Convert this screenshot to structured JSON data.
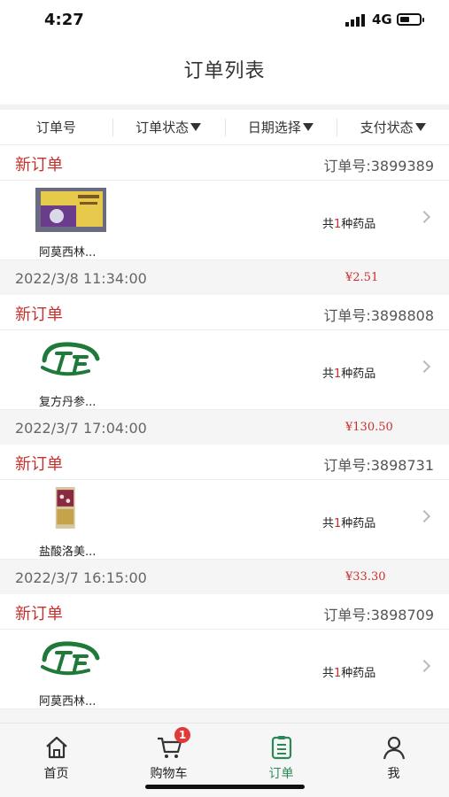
{
  "status_bar": {
    "time": "4:27",
    "network": "4G"
  },
  "page_title": "订单列表",
  "filters": [
    {
      "label": "订单号",
      "dropdown": false
    },
    {
      "label": "订单状态",
      "dropdown": true
    },
    {
      "label": "日期选择",
      "dropdown": true
    },
    {
      "label": "支付状态",
      "dropdown": true
    }
  ],
  "orders": [
    {
      "status": "新订单",
      "number": "订单号:3899389",
      "product_name": "阿莫西林...",
      "count_prefix": "共",
      "count": "1",
      "count_suffix": "种药品",
      "date": "2022/3/8 11:34:00",
      "price": "¥2.51",
      "image": "medicine-box"
    },
    {
      "status": "新订单",
      "number": "订单号:3898808",
      "product_name": "复方丹参...",
      "count_prefix": "共",
      "count": "1",
      "count_suffix": "种药品",
      "date": "2022/3/7 17:04:00",
      "price": "¥130.50",
      "image": "logo"
    },
    {
      "status": "新订单",
      "number": "订单号:3898731",
      "product_name": "盐酸洛美...",
      "count_prefix": "共",
      "count": "1",
      "count_suffix": "种药品",
      "date": "2022/3/7 16:15:00",
      "price": "¥33.30",
      "image": "medicine-bottle"
    },
    {
      "status": "新订单",
      "number": "订单号:3898709",
      "product_name": "阿莫西林...",
      "count_prefix": "共",
      "count": "1",
      "count_suffix": "种药品",
      "date": "",
      "price": "",
      "image": "logo"
    }
  ],
  "tabbar": [
    {
      "label": "首页",
      "icon": "home-icon"
    },
    {
      "label": "购物车",
      "icon": "cart-icon",
      "badge": "1"
    },
    {
      "label": "订单",
      "icon": "order-list-icon",
      "active": true
    },
    {
      "label": "我",
      "icon": "user-icon"
    }
  ],
  "colors": {
    "accent_red": "#c9302c",
    "active_green": "#2a8a56"
  }
}
